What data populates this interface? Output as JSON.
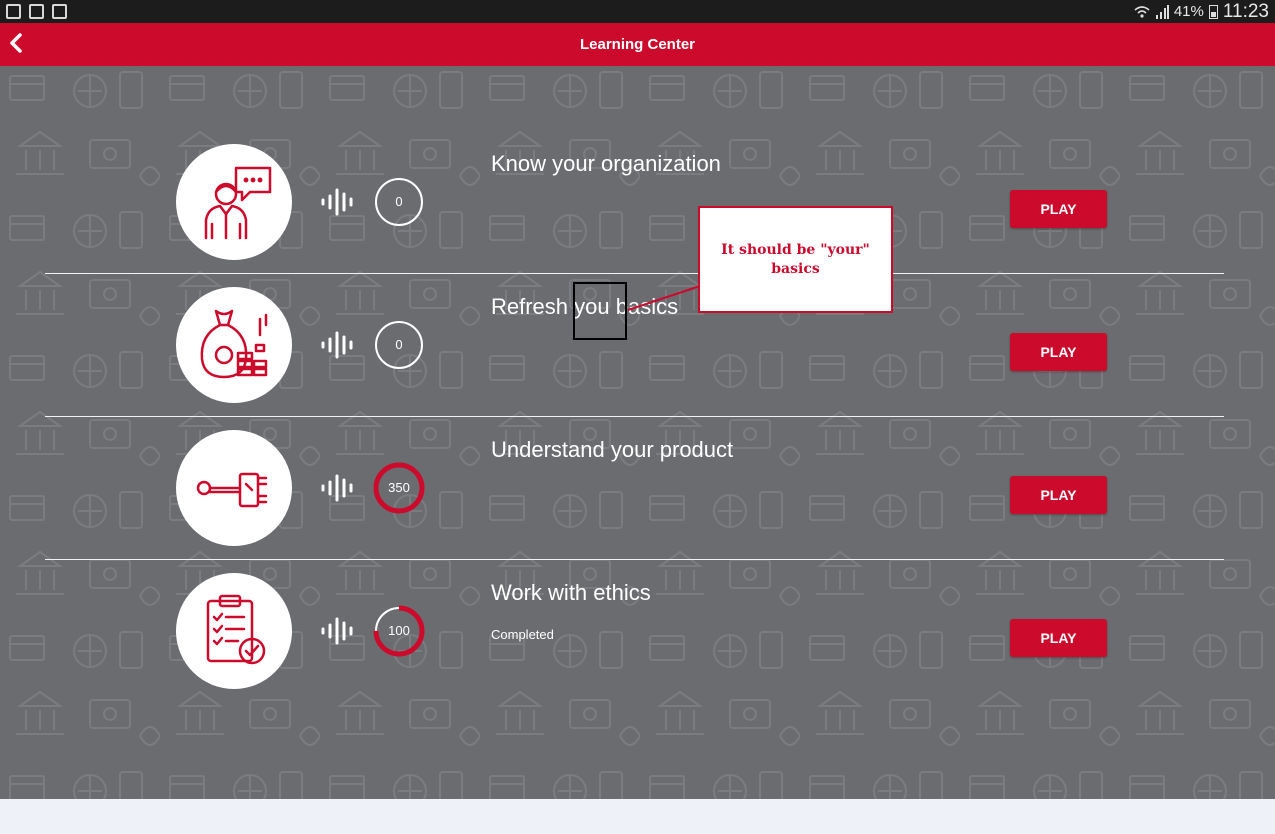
{
  "status_bar": {
    "battery": "41%",
    "time": "11:23"
  },
  "app_bar": {
    "title": "Learning Center",
    "back_icon": "chevron-left-icon"
  },
  "colors": {
    "brand_red": "#cc0a2c",
    "content_bg": "#6b6c70",
    "white": "#ffffff"
  },
  "lessons": [
    {
      "title": "Know your organization",
      "score": "0",
      "score_progress": 0,
      "status": "",
      "play_label": "PLAY",
      "icon": "presenter-speech-bubble-icon"
    },
    {
      "title": "Refresh you basics",
      "score": "0",
      "score_progress": 0,
      "status": "",
      "play_label": "PLAY",
      "icon": "money-bag-coins-icon"
    },
    {
      "title": "Understand your product",
      "score": "350",
      "score_progress": 1,
      "status": "",
      "play_label": "PLAY",
      "icon": "key-lock-icon"
    },
    {
      "title": "Work with ethics",
      "score": "100",
      "score_progress": 0.75,
      "status": "Completed",
      "play_label": "PLAY",
      "icon": "checklist-clipboard-icon"
    }
  ],
  "annotation": {
    "callout_text": "It should be \"your\" basics"
  }
}
